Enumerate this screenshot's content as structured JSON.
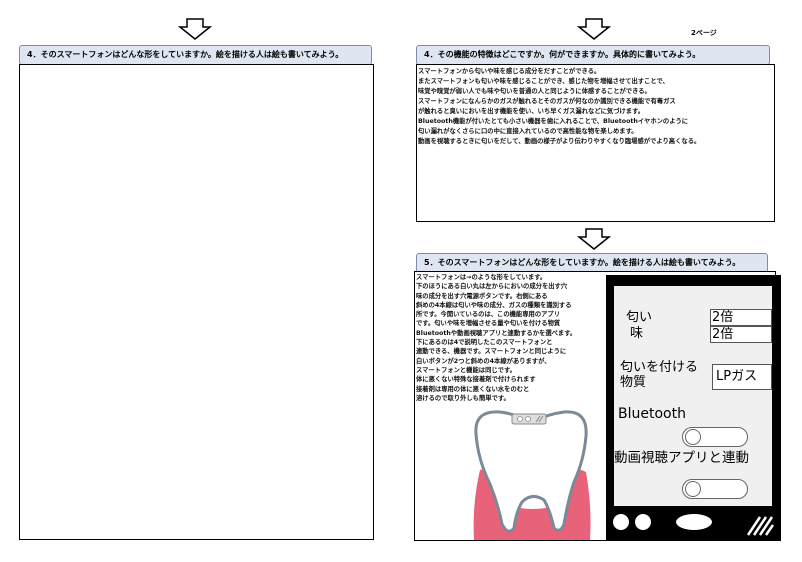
{
  "page_label": "2ページ",
  "left_panel": {
    "question": "4．そのスマートフォンはどんな形をしていますか。絵を描ける人は絵も書いてみよう。"
  },
  "right_top_panel": {
    "question": "4．その機能の特徴はどこですか。何ができますか。具体的に書いてみよう。",
    "answer_lines": [
      "スマートフォンから匂いや味を感じる成分をだすことができる。",
      "またスマートフォンも匂いや味を感じることができ、感じた物を増幅させて出すことで、",
      "味覚や嗅覚が弱い人でも味や匂いを普通の人と同じように体感することができる。",
      "スマートフォンになんらかのガスが触れるとそのガスが何なのか識別できる機能で有毒ガス",
      "が触れると臭いにおいを出す機能を使い、いち早くガス漏れなどに気づけます。",
      "Bluetooth機能が付いたとても小さい機器を歯に入れることで、Bluetoothイヤホンのように",
      "匂い漏れがなくさらに口の中に直接入れているので高性能な物を楽しめます。",
      "動画を視聴するときに匂いをだして、動画の様子がより伝わりやすくなり臨場感がでより高くなる。"
    ]
  },
  "right_bottom_panel": {
    "question": "5．そのスマートフォンはどんな形をしていますか。絵を描ける人は絵も書いてみよう。",
    "answer_lines": [
      "スマートフォンは→のような形をしています。",
      "下のほうにある白い丸は左からにおいの成分を出す穴",
      "味の成分を出す穴電源ボタンです。右側にある",
      "斜めの4本線は匂いや味の成分、ガスの種類を識別する",
      "所です。今開いているのは、この機能専用のアプリ",
      "です。匂いや味を増幅させる量や匂いを付ける物質",
      "Bluetoothや動画視聴アプリと連動するかを選べます。",
      "下にあるのは4で説明したこのスマートフォンと",
      "連動できる、機器です。スマートフォンと同じように",
      "白いボタンが2つと斜めの4本線がありますが、",
      "スマートフォンと機能は同じです。",
      "体に悪くない特殊な接着剤で付けられます",
      "接着剤は専用の体に悪くない水をのむと",
      "溶けるので取り外しも簡単です。"
    ],
    "phone_screen": {
      "smell_label": "匂い",
      "smell_value": "2倍",
      "taste_label": "味",
      "taste_value": "2倍",
      "substance_label_1": "匂いを付ける",
      "substance_label_2": "物質",
      "substance_value": "LPガス",
      "bluetooth_label": "Bluetooth",
      "video_label": "動画視聴アプリと連動"
    }
  },
  "colors": {
    "header_bg": "#dfe6f1",
    "header_border": "#7f8ea6",
    "tooth": "#ffffff",
    "gum": "#e8627a"
  },
  "icons": [
    "down-arrow-icon",
    "tooth-device-icon",
    "sensor-lines-icon"
  ]
}
